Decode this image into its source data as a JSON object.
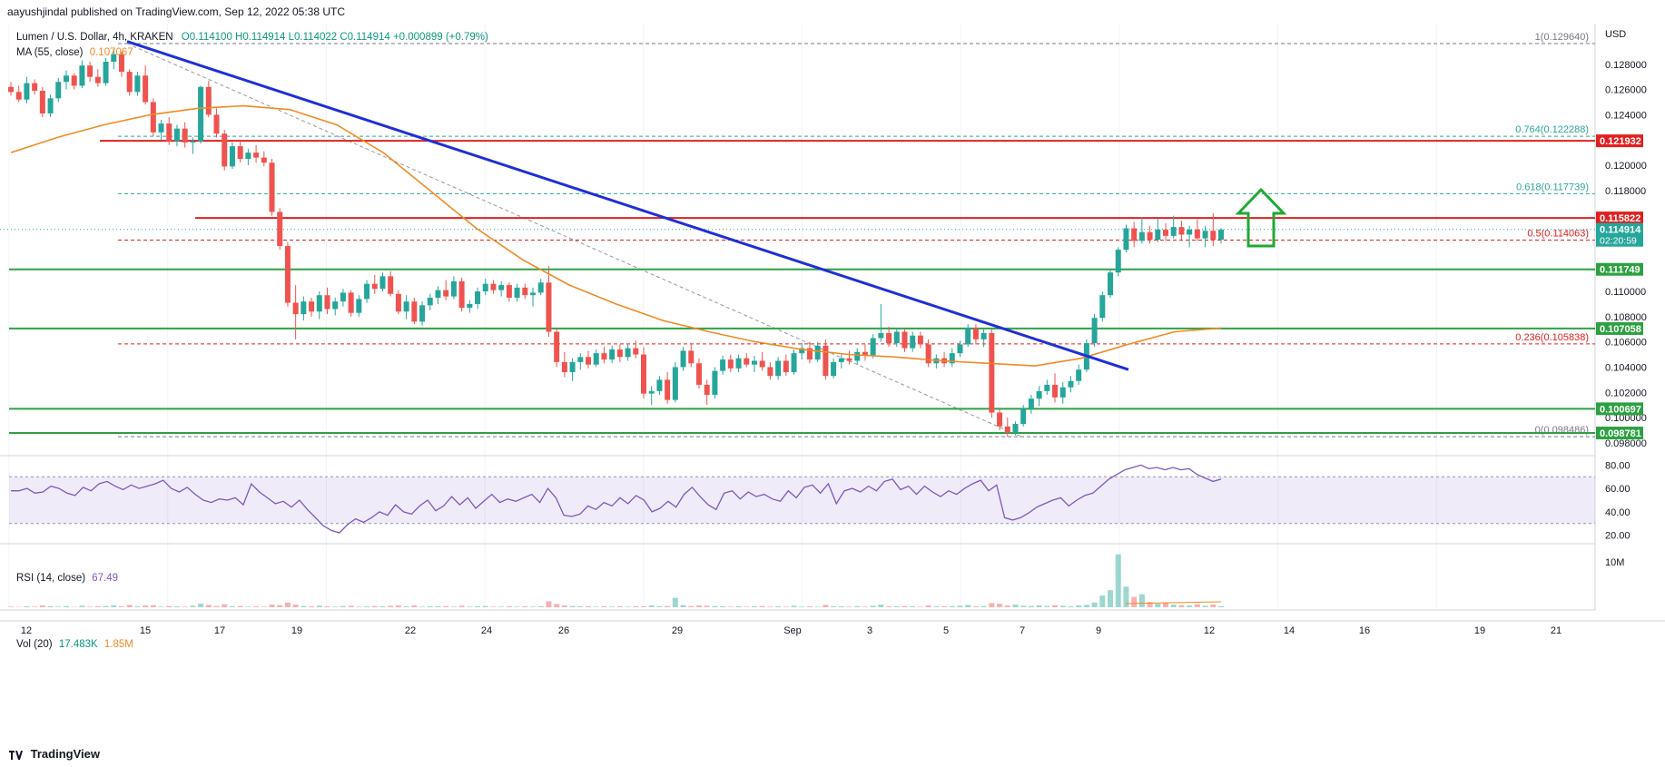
{
  "header": {
    "published": "aayushjindal published on TradingView.com, Sep 12, 2022 05:38 UTC"
  },
  "legend": {
    "symbol": "Lumen / U.S. Dollar, 4h, KRAKEN",
    "ohlc": "O0.114100 H0.114914 L0.114022 C0.114914 +0.000899 (+0.79%)",
    "ma_label": "MA (55, close)",
    "ma_value": "0.107067",
    "rsi_label": "RSI (14, close)",
    "rsi_value": "67.49",
    "vol_label": "Vol (20)",
    "vol_value": "17.483K",
    "vol_ma": "1.85M"
  },
  "footer": {
    "brand": "TradingView"
  },
  "colors": {
    "up": "#26a69a",
    "down": "#ef5350",
    "ma": "#f08a24",
    "trendline": "#1f2fd6",
    "resistance": "#e02020",
    "support": "#2ea043",
    "rsi": "#7e57c2",
    "arrow": "#21a835",
    "fib": "#2aa79b"
  },
  "chart_data": {
    "type": "candlestick",
    "price_axis": {
      "unit_label": "USD",
      "ticks": [
        "0.128000",
        "0.126000",
        "0.124000",
        "0.120000",
        "0.118000",
        "0.110000",
        "0.108000",
        "0.106000",
        "0.104000",
        "0.102000",
        "0.100000",
        "0.098000"
      ],
      "ylim": [
        0.0972,
        0.1305
      ]
    },
    "time_axis": {
      "ticks": [
        "12",
        "15",
        "17",
        "19",
        "22",
        "24",
        "26",
        "29",
        "Sep",
        "3",
        "5",
        "7",
        "9",
        "12",
        "14",
        "16",
        "19",
        "21"
      ]
    },
    "price_markers": [
      {
        "label": "0.121932",
        "kind": "resistance"
      },
      {
        "label": "0.115822",
        "kind": "resistance"
      },
      {
        "label": "0.114914",
        "sub": "02:20:59",
        "kind": "last"
      },
      {
        "label": "0.111749",
        "kind": "support"
      },
      {
        "label": "0.107058",
        "kind": "support"
      },
      {
        "label": "0.100697",
        "kind": "support"
      },
      {
        "label": "0.098781",
        "kind": "support"
      }
    ],
    "fib_levels": [
      {
        "label": "1(0.129640)",
        "value": 0.12964
      },
      {
        "label": "0.764(0.122288)",
        "value": 0.122288
      },
      {
        "label": "0.618(0.117739)",
        "value": 0.117739
      },
      {
        "label": "0.5(0.114063)",
        "value": 0.114063
      },
      {
        "label": "0.236(0.105838)",
        "value": 0.105838
      },
      {
        "label": "0(0.098486)",
        "value": 0.098486
      }
    ],
    "horizontal_lines": [
      {
        "value": 0.121932,
        "kind": "resistance"
      },
      {
        "value": 0.115822,
        "kind": "resistance"
      },
      {
        "value": 0.111749,
        "kind": "support"
      },
      {
        "value": 0.107058,
        "kind": "support"
      },
      {
        "value": 0.100697,
        "kind": "support"
      },
      {
        "value": 0.098781,
        "kind": "support"
      }
    ],
    "trendline": {
      "from": [
        0.0,
        0.1298
      ],
      "to": [
        0.69,
        0.1038
      ]
    },
    "candles": [
      [
        0.1262,
        0.1266,
        0.1255,
        0.1258
      ],
      [
        0.1258,
        0.1263,
        0.125,
        0.1252
      ],
      [
        0.1252,
        0.127,
        0.1249,
        0.1265
      ],
      [
        0.1265,
        0.1268,
        0.1256,
        0.1259
      ],
      [
        0.1259,
        0.1262,
        0.1238,
        0.1241
      ],
      [
        0.1241,
        0.1256,
        0.1238,
        0.1253
      ],
      [
        0.1253,
        0.1269,
        0.125,
        0.1266
      ],
      [
        0.1266,
        0.1275,
        0.126,
        0.1271
      ],
      [
        0.1271,
        0.1273,
        0.126,
        0.1263
      ],
      [
        0.1263,
        0.1283,
        0.1261,
        0.1279
      ],
      [
        0.1279,
        0.1282,
        0.1266,
        0.127
      ],
      [
        0.127,
        0.1276,
        0.1262,
        0.1265
      ],
      [
        0.1265,
        0.1285,
        0.1263,
        0.1282
      ],
      [
        0.1282,
        0.1292,
        0.1276,
        0.1288
      ],
      [
        0.1288,
        0.129,
        0.127,
        0.1274
      ],
      [
        0.1274,
        0.1276,
        0.1255,
        0.1258
      ],
      [
        0.1258,
        0.1274,
        0.1255,
        0.1271
      ],
      [
        0.1271,
        0.1279,
        0.1248,
        0.125
      ],
      [
        0.125,
        0.1253,
        0.1223,
        0.1226
      ],
      [
        0.1226,
        0.1236,
        0.122,
        0.1233
      ],
      [
        0.1233,
        0.1238,
        0.1216,
        0.1219
      ],
      [
        0.1219,
        0.1232,
        0.1215,
        0.1229
      ],
      [
        0.1229,
        0.1234,
        0.1214,
        0.1218
      ],
      [
        0.1218,
        0.1222,
        0.1209,
        0.1219
      ],
      [
        0.1219,
        0.1263,
        0.1217,
        0.1262
      ],
      [
        0.1262,
        0.1267,
        0.1238,
        0.124
      ],
      [
        0.124,
        0.1245,
        0.1222,
        0.1225
      ],
      [
        0.1225,
        0.1228,
        0.1196,
        0.1199
      ],
      [
        0.1199,
        0.1218,
        0.1197,
        0.1215
      ],
      [
        0.1215,
        0.1219,
        0.1202,
        0.1205
      ],
      [
        0.1205,
        0.1213,
        0.12,
        0.121
      ],
      [
        0.121,
        0.1216,
        0.1202,
        0.1206
      ],
      [
        0.1206,
        0.1211,
        0.1199,
        0.1202
      ],
      [
        0.1202,
        0.1205,
        0.116,
        0.1163
      ],
      [
        0.1163,
        0.1166,
        0.1133,
        0.1136
      ],
      [
        0.1136,
        0.1139,
        0.1088,
        0.1091
      ],
      [
        0.1091,
        0.1105,
        0.1062,
        0.1082
      ],
      [
        0.1082,
        0.1096,
        0.1077,
        0.1092
      ],
      [
        0.1092,
        0.1095,
        0.108,
        0.1084
      ],
      [
        0.1084,
        0.11,
        0.1078,
        0.1097
      ],
      [
        0.1097,
        0.1103,
        0.1082,
        0.1086
      ],
      [
        0.1086,
        0.1095,
        0.1081,
        0.1092
      ],
      [
        0.1092,
        0.1102,
        0.1088,
        0.1099
      ],
      [
        0.1099,
        0.1101,
        0.108,
        0.1083
      ],
      [
        0.1083,
        0.1097,
        0.108,
        0.1094
      ],
      [
        0.1094,
        0.1109,
        0.1091,
        0.1106
      ],
      [
        0.1106,
        0.1113,
        0.1098,
        0.1102
      ],
      [
        0.1102,
        0.1115,
        0.11,
        0.1112
      ],
      [
        0.1112,
        0.1116,
        0.1096,
        0.1098
      ],
      [
        0.1098,
        0.1101,
        0.1082,
        0.1084
      ],
      [
        0.1084,
        0.1097,
        0.1078,
        0.1092
      ],
      [
        0.1092,
        0.1095,
        0.1074,
        0.1076
      ],
      [
        0.1076,
        0.1092,
        0.1073,
        0.1089
      ],
      [
        0.1089,
        0.1098,
        0.1085,
        0.1095
      ],
      [
        0.1095,
        0.1104,
        0.109,
        0.1101
      ],
      [
        0.1101,
        0.1109,
        0.1093,
        0.1096
      ],
      [
        0.1096,
        0.1112,
        0.1094,
        0.1108
      ],
      [
        0.1108,
        0.1111,
        0.1084,
        0.1087
      ],
      [
        0.1087,
        0.1093,
        0.1083,
        0.109
      ],
      [
        0.109,
        0.1103,
        0.1086,
        0.11
      ],
      [
        0.11,
        0.111,
        0.1097,
        0.1106
      ],
      [
        0.1106,
        0.1109,
        0.1098,
        0.1101
      ],
      [
        0.1101,
        0.1108,
        0.1096,
        0.1105
      ],
      [
        0.1105,
        0.1107,
        0.1092,
        0.1095
      ],
      [
        0.1095,
        0.1106,
        0.1092,
        0.1103
      ],
      [
        0.1103,
        0.1106,
        0.1094,
        0.1097
      ],
      [
        0.1097,
        0.1103,
        0.1088,
        0.1099
      ],
      [
        0.1099,
        0.111,
        0.1097,
        0.1107
      ],
      [
        0.1107,
        0.112,
        0.1064,
        0.1068
      ],
      [
        0.1068,
        0.1071,
        0.104,
        0.1044
      ],
      [
        0.1044,
        0.1052,
        0.1032,
        0.1036
      ],
      [
        0.1036,
        0.1047,
        0.1029,
        0.1044
      ],
      [
        0.1044,
        0.1051,
        0.1038,
        0.1048
      ],
      [
        0.1048,
        0.1053,
        0.1039,
        0.1042
      ],
      [
        0.1042,
        0.1054,
        0.104,
        0.1051
      ],
      [
        0.1051,
        0.1056,
        0.1043,
        0.1046
      ],
      [
        0.1046,
        0.1057,
        0.1043,
        0.1054
      ],
      [
        0.1054,
        0.1058,
        0.1044,
        0.1048
      ],
      [
        0.1048,
        0.1058,
        0.1045,
        0.1055
      ],
      [
        0.1055,
        0.1061,
        0.1047,
        0.105
      ],
      [
        0.105,
        0.1056,
        0.1015,
        0.1019
      ],
      [
        0.1019,
        0.1025,
        0.101,
        0.1021
      ],
      [
        0.1021,
        0.1033,
        0.1018,
        0.103
      ],
      [
        0.103,
        0.1036,
        0.1011,
        0.1014
      ],
      [
        0.1014,
        0.1044,
        0.1012,
        0.104
      ],
      [
        0.104,
        0.1056,
        0.1037,
        0.1053
      ],
      [
        0.1053,
        0.1058,
        0.104,
        0.1043
      ],
      [
        0.1043,
        0.1047,
        0.1023,
        0.1026
      ],
      [
        0.1026,
        0.103,
        0.101,
        0.1018
      ],
      [
        0.1018,
        0.104,
        0.1015,
        0.1037
      ],
      [
        0.1037,
        0.1049,
        0.1034,
        0.1046
      ],
      [
        0.1046,
        0.105,
        0.1036,
        0.1039
      ],
      [
        0.1039,
        0.105,
        0.1036,
        0.1047
      ],
      [
        0.1047,
        0.1051,
        0.104,
        0.1042
      ],
      [
        0.1042,
        0.1049,
        0.1036,
        0.1045
      ],
      [
        0.1045,
        0.1052,
        0.1037,
        0.104
      ],
      [
        0.104,
        0.1044,
        0.103,
        0.1033
      ],
      [
        0.1033,
        0.1048,
        0.103,
        0.1045
      ],
      [
        0.1045,
        0.105,
        0.1033,
        0.1036
      ],
      [
        0.1036,
        0.1054,
        0.1034,
        0.1051
      ],
      [
        0.1051,
        0.1059,
        0.1046,
        0.1055
      ],
      [
        0.1055,
        0.106,
        0.1043,
        0.1046
      ],
      [
        0.1046,
        0.106,
        0.1044,
        0.1057
      ],
      [
        0.1057,
        0.1062,
        0.103,
        0.1033
      ],
      [
        0.1033,
        0.1047,
        0.1031,
        0.1044
      ],
      [
        0.1044,
        0.105,
        0.1039,
        0.1047
      ],
      [
        0.1047,
        0.1053,
        0.1042,
        0.1045
      ],
      [
        0.1045,
        0.1055,
        0.1042,
        0.1052
      ],
      [
        0.1052,
        0.1058,
        0.1045,
        0.1049
      ],
      [
        0.1049,
        0.1066,
        0.1047,
        0.1063
      ],
      [
        0.1063,
        0.109,
        0.106,
        0.1067
      ],
      [
        0.1067,
        0.1072,
        0.1056,
        0.1059
      ],
      [
        0.1059,
        0.1071,
        0.1056,
        0.1068
      ],
      [
        0.1068,
        0.107,
        0.1052,
        0.1055
      ],
      [
        0.1055,
        0.1068,
        0.1052,
        0.1065
      ],
      [
        0.1065,
        0.1068,
        0.1055,
        0.1058
      ],
      [
        0.1058,
        0.1062,
        0.104,
        0.1043
      ],
      [
        0.1043,
        0.105,
        0.1039,
        0.1047
      ],
      [
        0.1047,
        0.1052,
        0.104,
        0.1043
      ],
      [
        0.1043,
        0.1055,
        0.104,
        0.1051
      ],
      [
        0.1051,
        0.1061,
        0.1048,
        0.1058
      ],
      [
        0.1058,
        0.1074,
        0.1056,
        0.1071
      ],
      [
        0.1071,
        0.1074,
        0.1058,
        0.1062
      ],
      [
        0.1062,
        0.107,
        0.1056,
        0.1067
      ],
      [
        0.1067,
        0.107,
        0.1,
        0.1004
      ],
      [
        0.1004,
        0.1007,
        0.099,
        0.0993
      ],
      [
        0.0993,
        0.1,
        0.0985,
        0.0988
      ],
      [
        0.0988,
        0.0997,
        0.0986,
        0.0995
      ],
      [
        0.0995,
        0.101,
        0.0993,
        0.1007
      ],
      [
        0.1007,
        0.1018,
        0.1003,
        0.1015
      ],
      [
        0.1015,
        0.1025,
        0.1009,
        0.1021
      ],
      [
        0.1021,
        0.103,
        0.1018,
        0.1026
      ],
      [
        0.1026,
        0.1035,
        0.1012,
        0.1016
      ],
      [
        0.1016,
        0.1028,
        0.1011,
        0.1024
      ],
      [
        0.1024,
        0.1033,
        0.102,
        0.1029
      ],
      [
        0.1029,
        0.1042,
        0.1026,
        0.1038
      ],
      [
        0.1038,
        0.1062,
        0.1036,
        0.1059
      ],
      [
        0.1059,
        0.1082,
        0.1056,
        0.1079
      ],
      [
        0.1079,
        0.11,
        0.1076,
        0.1097
      ],
      [
        0.1097,
        0.1118,
        0.1095,
        0.1115
      ],
      [
        0.1115,
        0.1135,
        0.1112,
        0.1133
      ],
      [
        0.1133,
        0.1153,
        0.1131,
        0.115
      ],
      [
        0.115,
        0.1155,
        0.1135,
        0.114
      ],
      [
        0.114,
        0.1159,
        0.1138,
        0.1147
      ],
      [
        0.1147,
        0.1152,
        0.1138,
        0.1141
      ],
      [
        0.1141,
        0.1158,
        0.1139,
        0.1149
      ],
      [
        0.1149,
        0.1154,
        0.114,
        0.1144
      ],
      [
        0.1144,
        0.116,
        0.1142,
        0.1151
      ],
      [
        0.1151,
        0.1156,
        0.114,
        0.1145
      ],
      [
        0.1145,
        0.1152,
        0.1135,
        0.1149
      ],
      [
        0.1149,
        0.1157,
        0.114,
        0.1142
      ],
      [
        0.1142,
        0.1152,
        0.1135,
        0.1148
      ],
      [
        0.1148,
        0.1162,
        0.1136,
        0.1141
      ],
      [
        0.1141,
        0.115,
        0.1138,
        0.1149
      ]
    ],
    "ma": [
      0.121,
      0.1222,
      0.1232,
      0.124,
      0.1245,
      0.1247,
      0.1244,
      0.1232,
      0.121,
      0.118,
      0.115,
      0.1125,
      0.1105,
      0.109,
      0.1077,
      0.1068,
      0.106,
      0.1054,
      0.105,
      0.1048,
      0.1045,
      0.1043,
      0.1041,
      0.1047,
      0.1058,
      0.1068,
      0.1071
    ],
    "rsi": {
      "levels": [
        70,
        30
      ],
      "ticks": [
        "80.00",
        "60.00",
        "40.00",
        "20.00"
      ],
      "values": [
        58,
        58,
        60,
        56,
        57,
        62,
        60,
        56,
        54,
        61,
        58,
        64,
        66,
        62,
        59,
        63,
        60,
        62,
        64,
        67,
        60,
        57,
        61,
        55,
        50,
        48,
        51,
        50,
        52,
        46,
        64,
        57,
        52,
        47,
        49,
        44,
        50,
        42,
        35,
        28,
        24,
        22,
        29,
        34,
        31,
        35,
        40,
        37,
        46,
        40,
        38,
        45,
        50,
        41,
        45,
        53,
        46,
        52,
        43,
        49,
        55,
        48,
        51,
        49,
        52,
        55,
        48,
        60,
        52,
        37,
        36,
        38,
        45,
        42,
        48,
        45,
        52,
        47,
        54,
        50,
        40,
        43,
        49,
        44,
        55,
        61,
        53,
        46,
        42,
        56,
        58,
        51,
        57,
        53,
        55,
        51,
        49,
        58,
        52,
        61,
        63,
        56,
        64,
        47,
        58,
        60,
        57,
        62,
        58,
        66,
        68,
        59,
        62,
        55,
        62,
        57,
        53,
        58,
        55,
        60,
        64,
        67,
        58,
        63,
        35,
        33,
        35,
        39,
        44,
        47,
        50,
        52,
        45,
        50,
        54,
        56,
        62,
        68,
        72,
        76,
        78,
        80,
        77,
        78,
        76,
        78,
        76,
        77,
        72,
        69,
        66,
        68
      ]
    },
    "volume": {
      "ticks": [
        "10M"
      ],
      "values": [
        0.2,
        0.1,
        0.3,
        0.2,
        0.6,
        0.3,
        0.2,
        0.4,
        0.1,
        0.5,
        0.2,
        0.3,
        0.4,
        0.6,
        0.3,
        0.8,
        0.3,
        0.6,
        0.7,
        0.2,
        0.4,
        0.3,
        0.2,
        0.5,
        1.2,
        0.8,
        0.4,
        1.0,
        0.3,
        0.4,
        0.2,
        0.3,
        0.2,
        0.9,
        0.7,
        1.6,
        0.9,
        0.4,
        0.3,
        0.5,
        0.3,
        0.2,
        0.4,
        0.5,
        0.2,
        0.3,
        0.4,
        0.3,
        0.5,
        0.6,
        0.3,
        0.6,
        0.2,
        0.3,
        0.3,
        0.4,
        0.2,
        0.5,
        0.2,
        0.3,
        0.4,
        0.2,
        0.2,
        0.3,
        0.2,
        0.3,
        0.2,
        0.3,
        2.0,
        1.1,
        0.6,
        0.4,
        0.3,
        0.3,
        0.2,
        0.3,
        0.2,
        0.3,
        0.2,
        0.3,
        0.3,
        0.6,
        0.3,
        0.4,
        3.2,
        0.7,
        0.4,
        0.6,
        0.5,
        0.4,
        0.3,
        0.2,
        0.3,
        0.2,
        0.3,
        0.4,
        0.2,
        0.3,
        0.2,
        0.5,
        0.2,
        0.3,
        0.2,
        0.8,
        0.3,
        0.3,
        0.2,
        0.4,
        0.2,
        0.5,
        0.9,
        0.3,
        0.3,
        0.4,
        0.3,
        0.2,
        0.6,
        0.3,
        0.3,
        0.4,
        0.5,
        0.8,
        0.3,
        0.4,
        1.4,
        1.2,
        0.6,
        0.9,
        0.5,
        0.4,
        0.6,
        0.4,
        0.7,
        0.5,
        0.3,
        0.6,
        0.8,
        1.6,
        4.0,
        5.8,
        18.0,
        7.0,
        3.5,
        4.4,
        1.8,
        1.2,
        1.6,
        0.9,
        0.7,
        0.6,
        1.0,
        0.5,
        0.9,
        0.4
      ],
      "ma": [
        1.85
      ]
    }
  }
}
